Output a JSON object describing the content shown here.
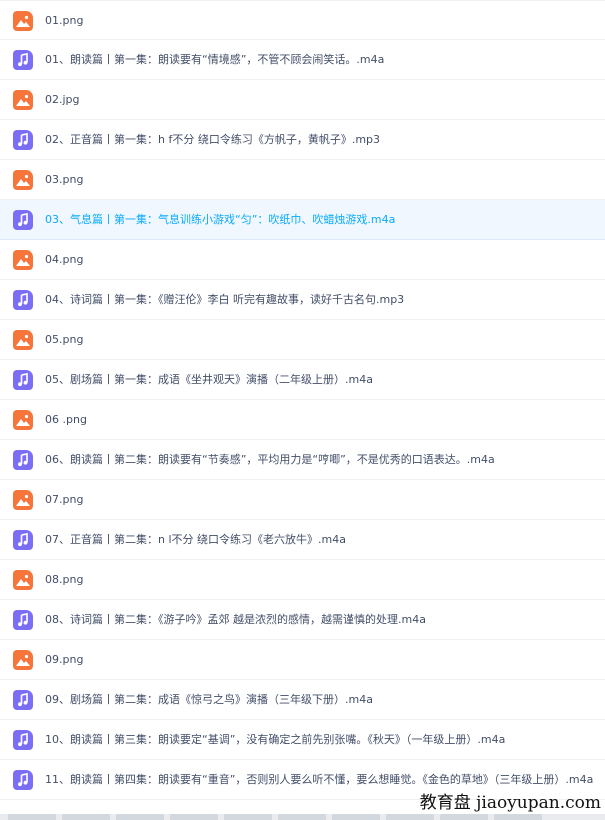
{
  "files": [
    {
      "name": "01.png",
      "kind": "image",
      "icon": "image-file-icon"
    },
    {
      "name": "01、朗读篇丨第一集：朗读要有“情境感”，不管不顾会闹笑话。.m4a",
      "kind": "audio",
      "icon": "audio-file-icon"
    },
    {
      "name": "02.jpg",
      "kind": "image",
      "icon": "image-file-icon"
    },
    {
      "name": "02、正音篇丨第一集：h f不分 绕口令练习《方帆子，黄帆子》.mp3",
      "kind": "audio",
      "icon": "audio-file-icon"
    },
    {
      "name": "03.png",
      "kind": "image",
      "icon": "image-file-icon"
    },
    {
      "name": "03、气息篇丨第一集：气息训练小游戏“匀”：吹纸巾、吹蜡烛游戏.m4a",
      "kind": "audio",
      "icon": "audio-file-icon",
      "selected": true
    },
    {
      "name": "04.png",
      "kind": "image",
      "icon": "image-file-icon"
    },
    {
      "name": "04、诗词篇丨第一集：《赠汪伦》李白 听完有趣故事，读好千古名句.mp3",
      "kind": "audio",
      "icon": "audio-file-icon"
    },
    {
      "name": "05.png",
      "kind": "image",
      "icon": "image-file-icon"
    },
    {
      "name": "05、剧场篇丨第一集：成语《坐井观天》演播（二年级上册）.m4a",
      "kind": "audio",
      "icon": "audio-file-icon"
    },
    {
      "name": "06 .png",
      "kind": "image",
      "icon": "image-file-icon"
    },
    {
      "name": "06、朗读篇丨第二集：朗读要有“节奏感”，平均用力是“哼唧”，不是优秀的口语表达。.m4a",
      "kind": "audio",
      "icon": "audio-file-icon"
    },
    {
      "name": "07.png",
      "kind": "image",
      "icon": "image-file-icon"
    },
    {
      "name": "07、正音篇丨第二集：n l不分 绕口令练习《老六放牛》.m4a",
      "kind": "audio",
      "icon": "audio-file-icon"
    },
    {
      "name": "08.png",
      "kind": "image",
      "icon": "image-file-icon"
    },
    {
      "name": "08、诗词篇丨第二集：《游子吟》孟郊 越是浓烈的感情，越需谨慎的处理.m4a",
      "kind": "audio",
      "icon": "audio-file-icon"
    },
    {
      "name": "09.png",
      "kind": "image",
      "icon": "image-file-icon"
    },
    {
      "name": "09、剧场篇丨第二集：成语《惊弓之鸟》演播（三年级下册）.m4a",
      "kind": "audio",
      "icon": "audio-file-icon"
    },
    {
      "name": "10、朗读篇丨第三集：朗读要定“基调”，没有确定之前先别张嘴。《秋天》（一年级上册）.m4a",
      "kind": "audio",
      "icon": "audio-file-icon"
    },
    {
      "name": "11、朗读篇丨第四集：朗读要有“重音”，否则别人要么听不懂，要么想睡觉。《金色的草地》（三年级上册）.m4a",
      "kind": "audio",
      "icon": "audio-file-icon"
    }
  ],
  "colors": {
    "image_icon": "#f5753b",
    "audio_icon": "#7b6ef5",
    "selected_text": "#09aaff",
    "selected_bg": "#f0f7ff",
    "text": "#424e67"
  },
  "watermark": "教育盘 jiaoyupan.com"
}
